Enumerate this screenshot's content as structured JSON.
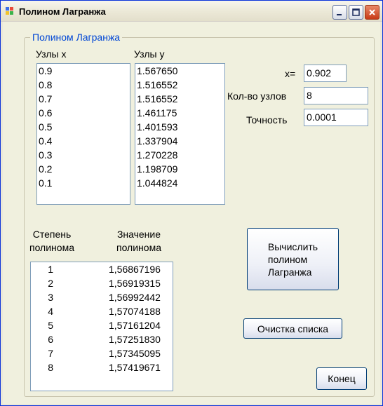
{
  "window": {
    "title": "Полином Лагранжа"
  },
  "group": {
    "title": "Полином Лагранжа"
  },
  "labels": {
    "nodes_x": "Узлы x",
    "nodes_y": "Узлы y",
    "x_eq": "x=",
    "node_count": "Кол-во узлов",
    "precision": "Точность",
    "degree": "Степень\nполинома",
    "value": "Значение\nполинома"
  },
  "inputs": {
    "x": "0.902",
    "node_count": "8",
    "precision": "0.0001"
  },
  "x_nodes": [
    "0.9",
    "0.8",
    "0.7",
    "0.6",
    "0.5",
    "0.4",
    "0.3",
    "0.2",
    "0.1"
  ],
  "y_nodes": [
    "1.567650",
    "1.516552",
    "1.516552",
    "1.461175",
    "1.401593",
    "1.337904",
    "1.270228",
    "1.198709",
    "1.044824"
  ],
  "results": [
    {
      "degree": "1",
      "value": "1,56867196"
    },
    {
      "degree": "2",
      "value": "1,56919315"
    },
    {
      "degree": "3",
      "value": "1,56992442"
    },
    {
      "degree": "4",
      "value": "1,57074188"
    },
    {
      "degree": "5",
      "value": "1,57161204"
    },
    {
      "degree": "6",
      "value": "1,57251830"
    },
    {
      "degree": "7",
      "value": "1,57345095"
    },
    {
      "degree": "8",
      "value": "1,57419671"
    }
  ],
  "buttons": {
    "compute": "Вычислить\nполином\nЛагранжа",
    "clear": "Очистка списка",
    "exit": "Конец"
  }
}
